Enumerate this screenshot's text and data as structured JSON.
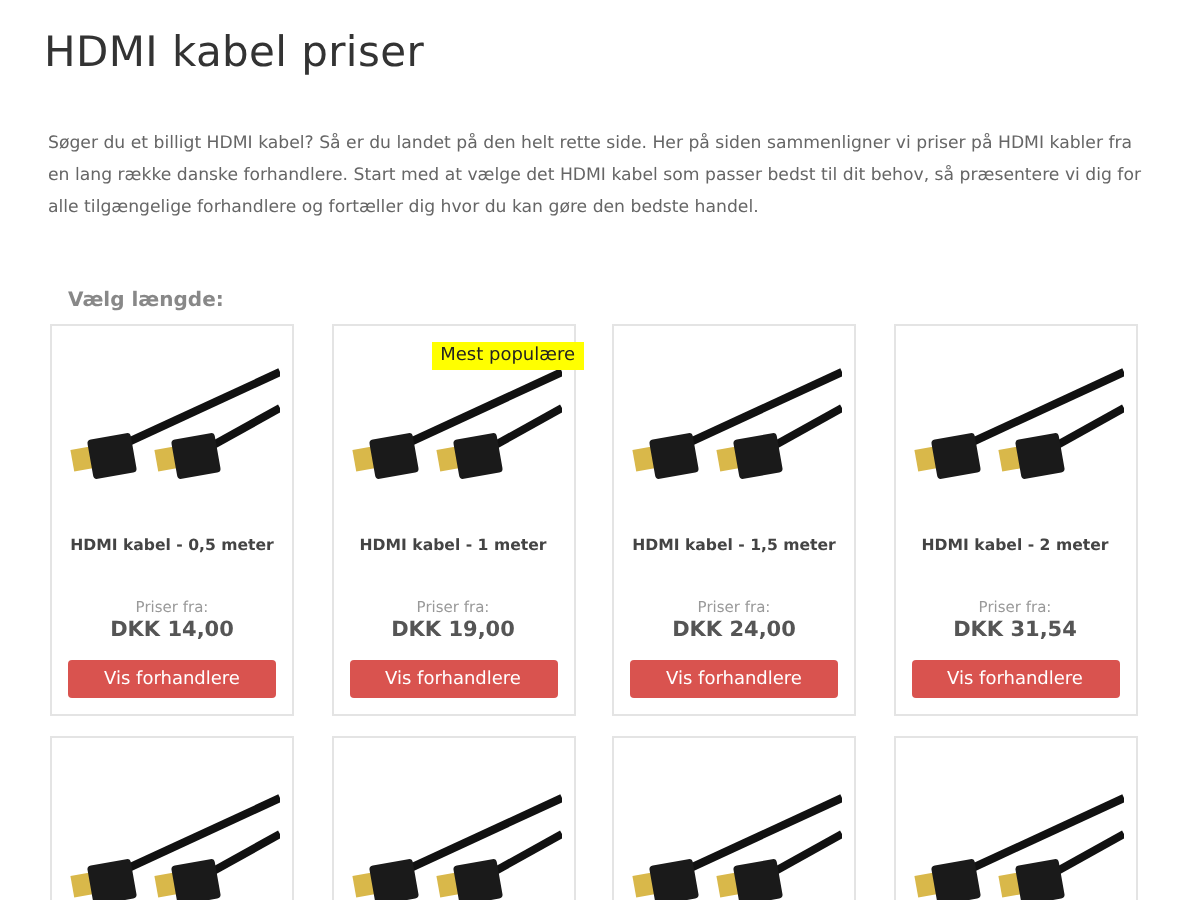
{
  "page": {
    "title": "HDMI kabel priser",
    "intro": "Søger du et billigt HDMI kabel? Så er du landet på den helt rette side. Her på siden sammenligner vi priser på HDMI kabler fra en lang række danske forhandlere. Start med at vælge det HDMI kabel som passer bedst til dit behov, så præsentere vi dig for alle tilgængelige forhandlere og fortæller dig hvor du kan gøre den bedste handel.",
    "section_label": "Vælg længde:"
  },
  "products": [
    {
      "kind": "full",
      "name": "HDMI kabel - 0,5 meter",
      "price_label": "Priser fra:",
      "price": "DKK 14,00",
      "button": "Vis forhandlere"
    },
    {
      "kind": "full",
      "badge": "Mest populære",
      "name": "HDMI kabel - 1 meter",
      "price_label": "Priser fra:",
      "price": "DKK 19,00",
      "button": "Vis forhandlere"
    },
    {
      "kind": "full",
      "name": "HDMI kabel - 1,5 meter",
      "price_label": "Priser fra:",
      "price": "DKK 24,00",
      "button": "Vis forhandlere"
    },
    {
      "kind": "full",
      "name": "HDMI kabel - 2 meter",
      "price_label": "Priser fra:",
      "price": "DKK 31,54",
      "button": "Vis forhandlere"
    },
    {
      "kind": "cut"
    },
    {
      "kind": "cut"
    },
    {
      "kind": "cut"
    },
    {
      "kind": "cut"
    }
  ]
}
